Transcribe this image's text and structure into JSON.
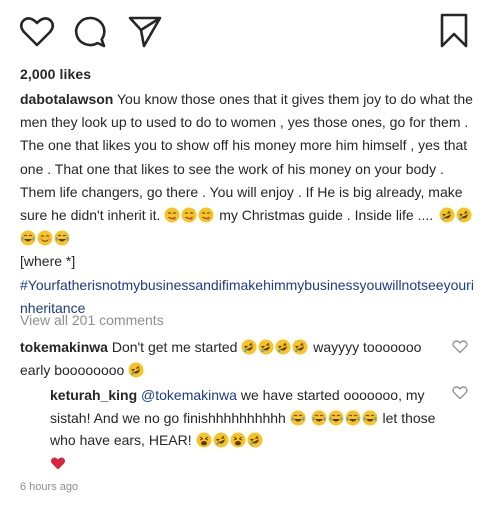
{
  "post": {
    "icons": [
      "heart-icon",
      "comment-icon",
      "share-icon",
      "bookmark-icon"
    ],
    "likes": "2,000 likes",
    "caption": {
      "username": "dabotalawson",
      "text": "You know those ones that it gives them joy to do what the men they look up to used to do to women , yes those ones, go for them . The one that likes you to show off his money more him himself , yes that one . That one that likes to see the work of his money on your body . Them life changers, go there . You will enjoy . If He is big already, make sure he didn't inherit it.",
      "guide_text": "my Christmas guide . Inside life ....",
      "where": "[where *]",
      "hashtag": "#Yourfatherisnotmybusinessandifimakehimmybusinessyouwillnotseeyourinheritance"
    },
    "view_all_comments": "View all 201 comments",
    "comments": [
      {
        "username": "tokemakinwa",
        "text_a": "Don't get me started",
        "text_b": "wayyyy tooooooo early boooooooo"
      },
      {
        "username": "keturah_king",
        "mention": "@tokemakinwa",
        "text_a": "we have started ooooooo, my sistah! And we no go finishhhhhhhhhh",
        "text_b": "let those who have ears, HEAR!"
      }
    ],
    "timestamp": "6 hours ago"
  },
  "colors": {
    "text": "#262626",
    "muted": "#8e8e8e",
    "hashtag": "#1b3c8a",
    "emoji_yellow": "#f7c325",
    "heart_red": "#d7263d"
  }
}
